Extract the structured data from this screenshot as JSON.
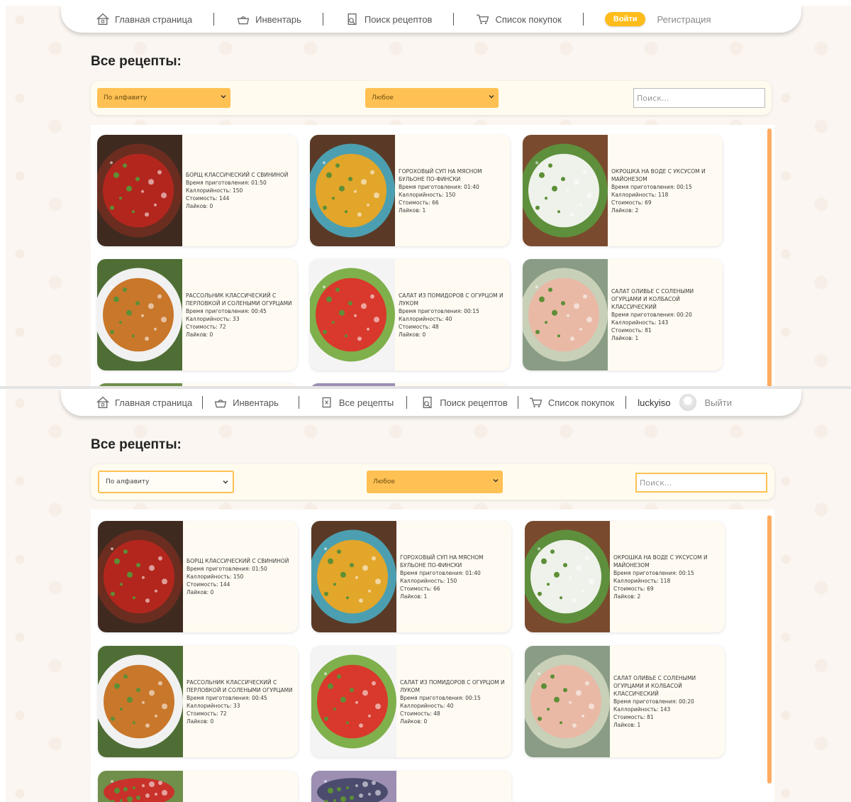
{
  "top": {
    "nav": {
      "home": "Главная страница",
      "inventory": "Инвентарь",
      "recipe_search": "Поиск рецептов",
      "shopping_list": "Список покупок",
      "login": "Войти",
      "register": "Регистрация"
    },
    "title": "Все рецепты:",
    "filters": {
      "sort": "По алфавиту",
      "category": "Любое",
      "search_placeholder": "Поиск..."
    }
  },
  "bottom": {
    "nav": {
      "home": "Главная страница",
      "inventory": "Инвентарь",
      "all_recipes": "Все рецепты",
      "recipe_search": "Поиск рецептов",
      "shopping_list": "Список покупок",
      "username": "luckyiso",
      "logout": "Выйти"
    },
    "title": "Все рецепты:",
    "filters": {
      "sort": "По алфавиту",
      "category": "Любое",
      "search_placeholder": "Поиск..."
    }
  },
  "recipes": [
    {
      "title": "Борщ классический с свининой",
      "time": "Время приготовления: 01:50",
      "calories": "Каллорийность: 150",
      "cost": "Стоимость: 144",
      "likes": "Лайков: 0",
      "colors": [
        "#b3261e",
        "#6b2d20",
        "#3f2a20"
      ]
    },
    {
      "title": "Гороховый суп на мясном бульоне по-фински",
      "time": "Время приготовления: 01:40",
      "calories": "Каллорийность: 150",
      "cost": "Стоимость: 66",
      "likes": "Лайков: 1",
      "colors": [
        "#e2a62a",
        "#4c9fb0",
        "#5a3a26"
      ]
    },
    {
      "title": "Окрошка на воде с уксусом и майонезом",
      "time": "Время приготовления: 00:15",
      "calories": "Каллорийность: 118",
      "cost": "Стоимость: 69",
      "likes": "Лайков: 2",
      "colors": [
        "#eef2ea",
        "#5e8f3c",
        "#7a4a2e"
      ]
    },
    {
      "title": "Рассольник классический с перловкой и солеными огурцами",
      "time": "Время приготовления: 00:45",
      "calories": "Каллорийность: 33",
      "cost": "Стоимость: 72",
      "likes": "Лайков: 0",
      "colors": [
        "#c9772b",
        "#f1f1f1",
        "#4f6e35"
      ]
    },
    {
      "title": "Салат из помидоров с огурцом и луком",
      "time": "Время приготовления: 00:15",
      "calories": "Каллорийность: 40",
      "cost": "Стоимость: 48",
      "likes": "Лайков: 0",
      "colors": [
        "#d8392c",
        "#7fb04c",
        "#f4f4f4"
      ]
    },
    {
      "title": "Салат оливье с солеными огурцами и колбасой классический",
      "time": "Время приготовления: 00:20",
      "calories": "Каллорийность: 143",
      "cost": "Стоимость: 81",
      "likes": "Лайков: 1",
      "colors": [
        "#e9b9a6",
        "#c8d0b8",
        "#8a9c85"
      ]
    }
  ],
  "stubs": [
    {
      "colors": [
        "#c8322a",
        "#6f8f4a"
      ]
    },
    {
      "colors": [
        "#4b4b6e",
        "#9c8fb2"
      ]
    }
  ]
}
